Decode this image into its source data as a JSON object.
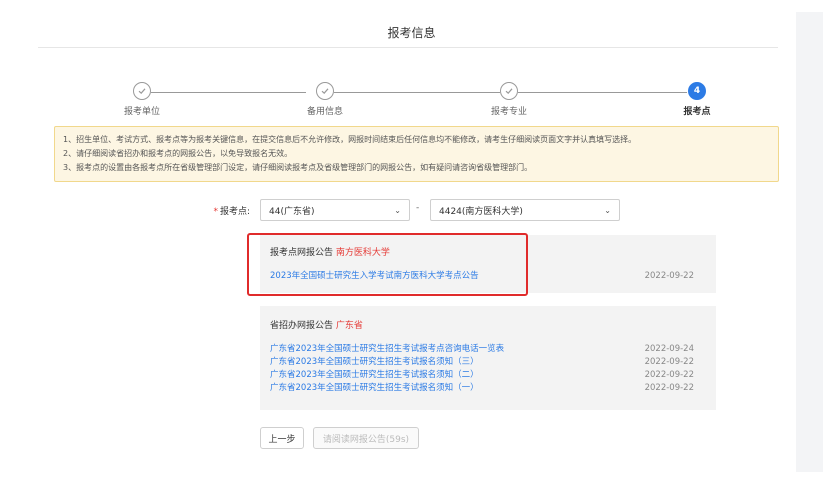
{
  "header": {
    "title": "报考信息"
  },
  "steps": [
    {
      "label": "报考单位",
      "state": "done"
    },
    {
      "label": "备用信息",
      "state": "done"
    },
    {
      "label": "报考专业",
      "state": "done"
    },
    {
      "label": "报考点",
      "state": "active",
      "number": "4"
    }
  ],
  "notice": {
    "lines": [
      "1、招生单位、考试方式、报考点等为报考关键信息，在提交信息后不允许修改，网报时间结束后任何信息均不能修改，请考生仔细阅读页面文字并认真填写选择。",
      "2、请仔细阅读省招办和报考点的网报公告，以免导致报名无效。",
      "3、报考点的设置由各报考点所在省级管理部门设定，请仔细阅读报考点及省级管理部门的网报公告，如有疑问请咨询省级管理部门。"
    ]
  },
  "form": {
    "label": "报考点:",
    "required_mark": "*",
    "province_select": "44(广东省)",
    "separator": "-",
    "site_select": "4424(南方医科大学)"
  },
  "site_notice": {
    "title": "报考点网报公告",
    "highlight": "南方医科大学",
    "items": [
      {
        "text": "2023年全国硕士研究生入学考试南方医科大学考点公告",
        "date": "2022-09-22"
      }
    ]
  },
  "province_notice": {
    "title": "省招办网报公告",
    "highlight": "广东省",
    "items": [
      {
        "text": "广东省2023年全国硕士研究生招生考试报考点咨询电话一览表",
        "date": "2022-09-24"
      },
      {
        "text": "广东省2023年全国硕士研究生招生考试报名须知（三）",
        "date": "2022-09-22"
      },
      {
        "text": "广东省2023年全国硕士研究生招生考试报名须知（二）",
        "date": "2022-09-22"
      },
      {
        "text": "广东省2023年全国硕士研究生招生考试报名须知（一）",
        "date": "2022-09-22"
      }
    ]
  },
  "buttons": {
    "prev": "上一步",
    "wait": "请阅读网报公告(59s)"
  },
  "colors": {
    "accent": "#2c7be5",
    "highlight": "#e53935",
    "notice_bg": "#fdf6e3",
    "annotation_box": "#e02b2b"
  }
}
